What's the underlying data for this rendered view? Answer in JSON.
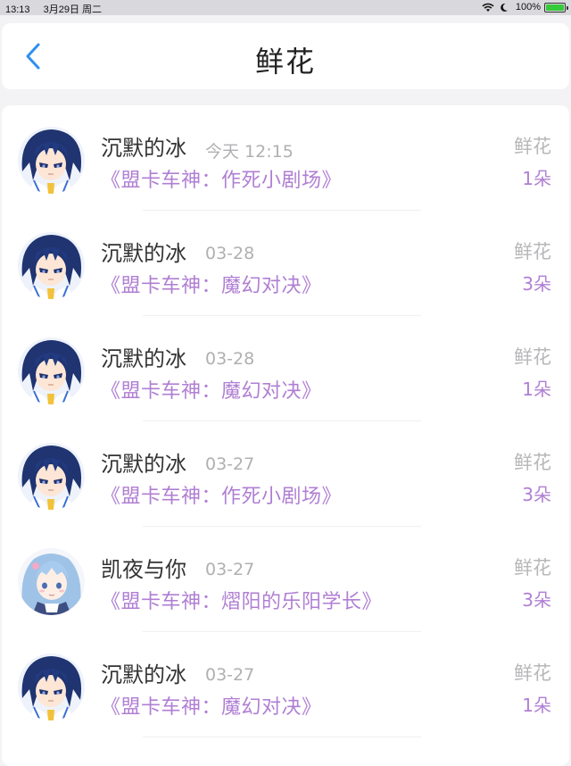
{
  "status_bar": {
    "time": "13:13",
    "date": "3月29日 周二",
    "battery": "100%"
  },
  "nav": {
    "title": "鲜花",
    "back_icon": "chevron-left-icon",
    "accent_color": "#2e8ff0"
  },
  "rows": [
    {
      "user": "沉默的冰",
      "time": "今天 12:15",
      "work": "《盟卡车神：作死小剧场》",
      "gift": "鲜花",
      "count": "1朵",
      "avatar": "blue-hair-boy"
    },
    {
      "user": "沉默的冰",
      "time": "03-28",
      "work": "《盟卡车神：魔幻对决》",
      "gift": "鲜花",
      "count": "3朵",
      "avatar": "blue-hair-boy"
    },
    {
      "user": "沉默的冰",
      "time": "03-28",
      "work": "《盟卡车神：魔幻对决》",
      "gift": "鲜花",
      "count": "1朵",
      "avatar": "blue-hair-boy"
    },
    {
      "user": "沉默的冰",
      "time": "03-27",
      "work": "《盟卡车神：作死小剧场》",
      "gift": "鲜花",
      "count": "3朵",
      "avatar": "blue-hair-boy"
    },
    {
      "user": "凯夜与你",
      "time": "03-27",
      "work": "《盟卡车神：熠阳的乐阳学长》",
      "gift": "鲜花",
      "count": "3朵",
      "avatar": "light-blue-hair-girl"
    },
    {
      "user": "沉默的冰",
      "time": "03-27",
      "work": "《盟卡车神：魔幻对决》",
      "gift": "鲜花",
      "count": "1朵",
      "avatar": "blue-hair-boy"
    }
  ]
}
